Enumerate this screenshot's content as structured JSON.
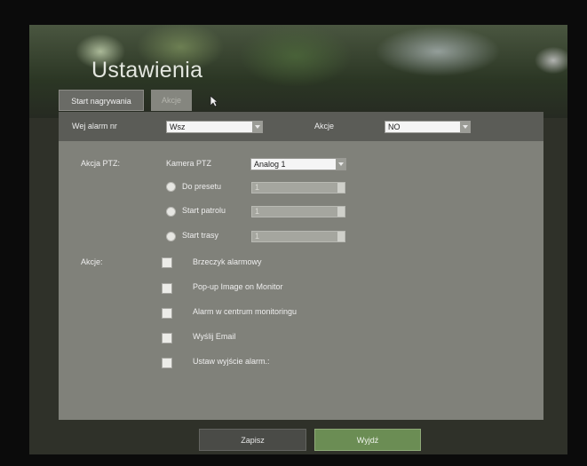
{
  "header": {
    "title": "Ustawienia"
  },
  "tabs": [
    {
      "label": "Start nagrywania"
    },
    {
      "label": "Akcje"
    }
  ],
  "top_row": {
    "input_label": "Wej alarm nr",
    "input_value": "Wsz",
    "actions_label": "Akcje",
    "actions_value": "NO"
  },
  "ptz": {
    "label": "Akcja PTZ:",
    "camera_label": "Kamera PTZ",
    "camera_value": "Analog 1",
    "options": [
      {
        "label": "Do presetu",
        "value": "1"
      },
      {
        "label": "Start patrolu",
        "value": "1"
      },
      {
        "label": "Start trasy",
        "value": "1"
      }
    ]
  },
  "actions": {
    "label": "Akcje:",
    "items": [
      {
        "label": "Brzeczyk alarmowy"
      },
      {
        "label": "Pop-up Image on Monitor"
      },
      {
        "label": "Alarm w centrum monitoringu"
      },
      {
        "label": "Wyślij Email"
      },
      {
        "label": "Ustaw wyjście alarm.:"
      }
    ]
  },
  "footer": {
    "save_label": "Zapisz",
    "exit_label": "Wyjdź"
  },
  "colors": {
    "accent_green": "#6b8d54",
    "panel": "#80817a",
    "header_row": "#5b5c57"
  }
}
